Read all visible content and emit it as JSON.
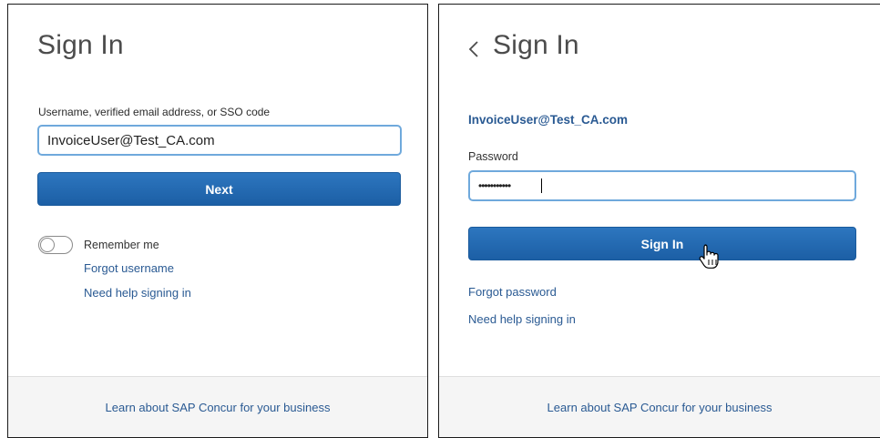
{
  "left_panel": {
    "title": "Sign In",
    "username_label": "Username, verified email address, or SSO code",
    "username_value": "InvoiceUser@Test_CA.com",
    "next_label": "Next",
    "remember_label": "Remember me",
    "remember_checked": false,
    "forgot_username": "Forgot username",
    "need_help": "Need help signing in",
    "footer_link": "Learn about SAP Concur for your business"
  },
  "right_panel": {
    "back_icon": "chevron-left-icon",
    "title": "Sign In",
    "user_email": "InvoiceUser@Test_CA.com",
    "password_label": "Password",
    "password_mask": "•••••••••••",
    "sign_in_label": "Sign In",
    "forgot_password": "Forgot password",
    "need_help": "Need help signing in",
    "footer_link": "Learn about SAP Concur for your business",
    "cursor_icon": "hand-pointer-icon"
  },
  "colors": {
    "button_blue": "#1f66ad",
    "link_blue": "#2a5a93",
    "input_border": "#6fa9dc",
    "title_gray": "#4c4c4c"
  }
}
